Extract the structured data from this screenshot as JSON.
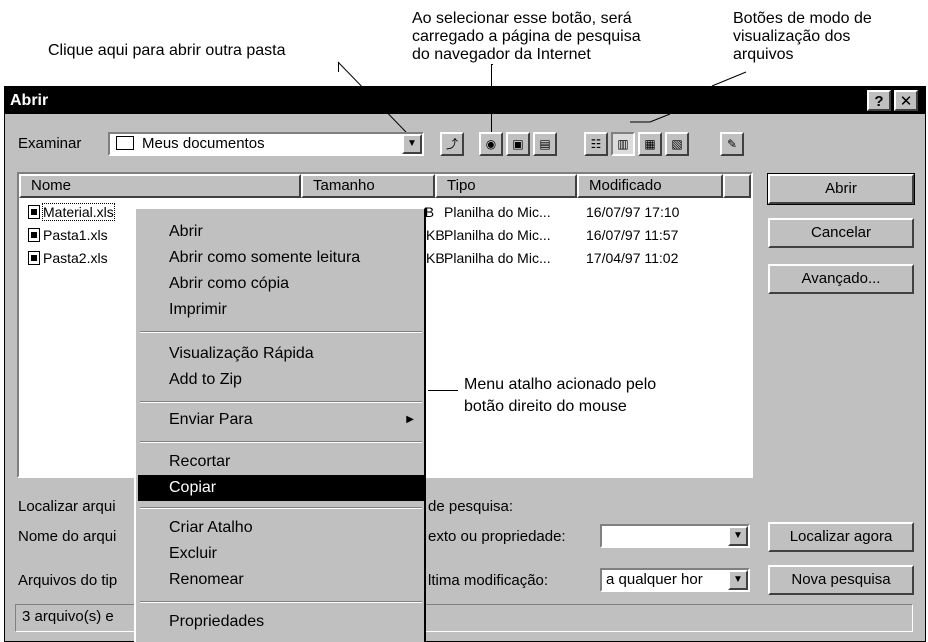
{
  "annotations": {
    "open_folder": "Clique aqui para abrir outra pasta",
    "search_button": [
      "Ao selecionar esse botão, será",
      "carregado a página de pesquisa",
      "do navegador da Internet"
    ],
    "view_modes": [
      "Botões de modo de",
      "visualização dos",
      "arquivos"
    ],
    "context_menu": [
      "Menu atalho acionado pelo",
      "botão direito do mouse"
    ]
  },
  "dialog": {
    "title": "Abrir",
    "help_button": "?",
    "close_button": "✕"
  },
  "toolbar": {
    "look_in_label": "Examinar",
    "look_in_value": "Meus documentos"
  },
  "file_list": {
    "columns": [
      "Nome",
      "Tamanho",
      "Tipo",
      "Modificado"
    ],
    "rows": [
      {
        "name": "Material.xls",
        "size": "14 KB",
        "type": "Planilha do Mic...",
        "modified": "16/07/97 17:10"
      },
      {
        "name": "Pasta1.xls",
        "size": "KB",
        "type": "Planilha do Mic...",
        "modified": "16/07/97 11:57"
      },
      {
        "name": "Pasta2.xls",
        "size": "KB",
        "type": "Planilha do Mic...",
        "modified": "17/04/97 11:02"
      }
    ]
  },
  "buttons": {
    "open": "Abrir",
    "cancel": "Cancelar",
    "advanced": "Avançado...",
    "find_now": "Localizar agora",
    "new_search": "Nova pesquisa"
  },
  "search": {
    "find_label": "Localizar arqui",
    "criteria_label": "de pesquisa:",
    "filename_label": "Nome do arqui",
    "text_prop_label": "exto ou propriedade:",
    "text_prop_value": "",
    "filetype_label": "Arquivos do tip",
    "last_modified_label": "ltima modificação:",
    "last_modified_value": "a qualquer hor"
  },
  "status": "3 arquivo(s) e",
  "context_menu": {
    "items": [
      "Abrir",
      "Abrir como somente leitura",
      "Abrir como cópia",
      "Imprimir",
      "Visualização Rápida",
      "Add to Zip",
      "Enviar Para",
      "Recortar",
      "Copiar",
      "Criar Atalho",
      "Excluir",
      "Renomear",
      "Propriedades"
    ],
    "highlighted": "Copiar"
  },
  "icons": [
    "folder-icon",
    "up-folder-icon",
    "search-web-icon",
    "favorites-icon",
    "add-favorites-icon",
    "list-view-icon",
    "details-view-icon",
    "properties-view-icon",
    "preview-view-icon",
    "commands-icon",
    "file-xls-icon",
    "submenu-arrow-icon",
    "dropdown-arrow-icon"
  ]
}
